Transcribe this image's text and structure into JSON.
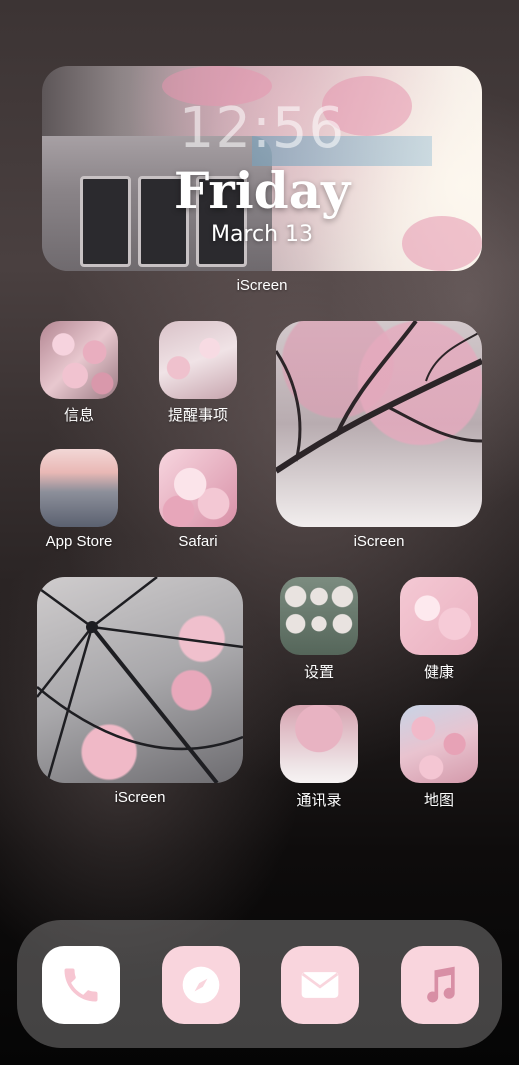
{
  "widget_clock": {
    "time": "12:56",
    "day": "Friday",
    "date": "March 13",
    "caption": "iScreen"
  },
  "apps_row1": [
    {
      "label": "信息"
    },
    {
      "label": "提醒事项"
    }
  ],
  "apps_row2": [
    {
      "label": "App Store"
    },
    {
      "label": "Safari"
    }
  ],
  "widget_photo_right": {
    "caption": "iScreen"
  },
  "widget_photo_left": {
    "caption": "iScreen"
  },
  "apps_row3": [
    {
      "label": "设置"
    },
    {
      "label": "健康"
    }
  ],
  "apps_row4": [
    {
      "label": "通讯录"
    },
    {
      "label": "地图"
    }
  ],
  "dock": {
    "apps": [
      {
        "icon": "phone-icon",
        "background": "#ffffff",
        "glyph_color": "#f7c6d2"
      },
      {
        "icon": "compass-icon",
        "background": "#f9d5dd",
        "glyph_color": "#ffffff"
      },
      {
        "icon": "mail-icon",
        "background": "#f9d5dd",
        "glyph_color": "#ffffff"
      },
      {
        "icon": "music-icon",
        "background": "#f9d5dd",
        "glyph_color": "#d88fa5"
      }
    ]
  }
}
